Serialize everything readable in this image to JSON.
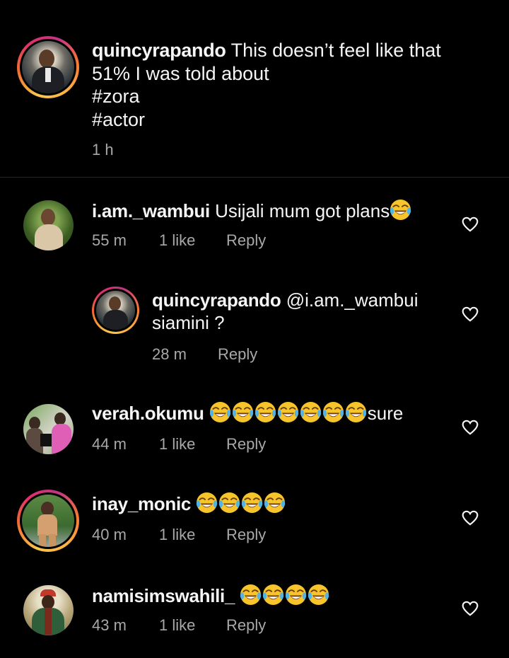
{
  "caption": {
    "username": "quincyrapando",
    "text_line1": " This doesn’t feel like that",
    "text_line2": "51% I was told about",
    "tag1": "#zora",
    "tag2": "#actor",
    "time": "1 h"
  },
  "comments": [
    {
      "username": "i.am._wambui",
      "text": " Usijali mum got plans",
      "emoji_count": 1,
      "time": "55 m",
      "likes": "1 like",
      "reply": "Reply",
      "avatar_colors": [
        "#3f6b2a",
        "#c8a27a"
      ]
    },
    {
      "username": "quincyrapando",
      "text_line1": " @i.am._wambui",
      "text_line2": "siamini ?",
      "time": "28 m",
      "reply": "Reply",
      "is_reply": true
    },
    {
      "username": "verah.okumu",
      "text": "sure",
      "emoji_count": 7,
      "time": "44 m",
      "likes": "1 like",
      "reply": "Reply"
    },
    {
      "username": "inay_monic",
      "text": "",
      "emoji_count": 4,
      "time": "40 m",
      "likes": "1 like",
      "reply": "Reply"
    },
    {
      "username": "namisimswahili_",
      "text": "",
      "emoji_count": 4,
      "time": "43 m",
      "likes": "1 like",
      "reply": "Reply"
    }
  ],
  "icons": {
    "like": "heart-outline-icon",
    "emoji": "face-with-tears-of-joy-icon"
  },
  "colors": {
    "background": "#000000",
    "text": "#f5f5f5",
    "muted": "#a8a8a8",
    "divider": "#262626"
  }
}
